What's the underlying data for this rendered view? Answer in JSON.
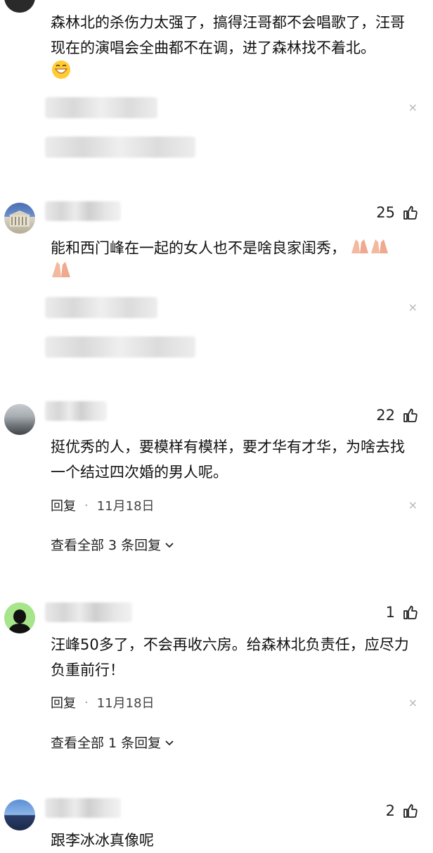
{
  "comments": [
    {
      "text": "森林北的杀伤力太强了，搞得汪哥都不会唱歌了，汪哥现在的演唱会全曲都不在调，进了森林找不着北。",
      "emoji": "grinning-emoji"
    },
    {
      "likes": "25",
      "text": "能和西门峰在一起的女人也不是啥良家闺秀，",
      "emoji": "pray-emoji"
    },
    {
      "likes": "22",
      "text": "挺优秀的人，要模样有模样，要才华有才华，为啥去找一个结过四次婚的男人呢。",
      "reply": "回复",
      "dot": "·",
      "date": "11月18日",
      "view_all": "查看全部 3 条回复"
    },
    {
      "likes": "1",
      "text": "汪峰50多了，不会再收六房。给森林北负责任，应尽力负重前行！",
      "reply": "回复",
      "dot": "·",
      "date": "11月18日",
      "view_all": "查看全部 1 条回复"
    },
    {
      "likes": "2",
      "text": "跟李冰冰真像呢"
    }
  ],
  "close_symbol": "×",
  "icons": {
    "like": "thumbs-up-icon",
    "chevron": "chevron-down-icon"
  }
}
